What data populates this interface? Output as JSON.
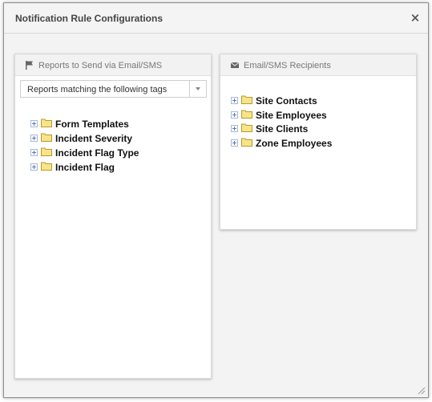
{
  "dialog": {
    "title": "Notification Rule Configurations",
    "close_symbol": "×"
  },
  "left_panel": {
    "title": "Reports to Send via Email/SMS",
    "icon": "flag-icon",
    "select": {
      "value": "Reports matching the following tags"
    },
    "tree": [
      {
        "label": "Form Templates"
      },
      {
        "label": "Incident Severity"
      },
      {
        "label": "Incident Flag Type"
      },
      {
        "label": "Incident Flag"
      }
    ]
  },
  "right_panel": {
    "title": "Email/SMS Recipients",
    "icon": "envelope-icon",
    "tree": [
      {
        "label": "Site Contacts"
      },
      {
        "label": "Site Employees"
      },
      {
        "label": "Site Clients"
      },
      {
        "label": "Zone Employees"
      }
    ]
  },
  "colors": {
    "folder_fill": "#f7e48a",
    "folder_stroke": "#b89a2a",
    "expander_border": "#a6b8d6"
  }
}
